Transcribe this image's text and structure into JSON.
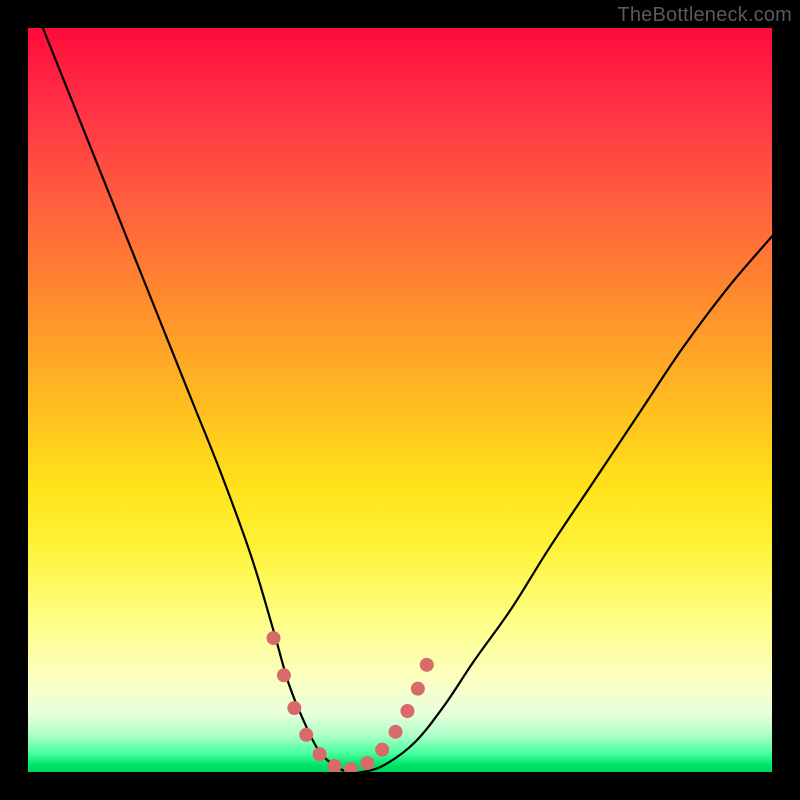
{
  "watermark": {
    "text": "TheBottleneck.com"
  },
  "colors": {
    "background": "#000000",
    "curve_stroke": "#000000",
    "marker_fill": "#d86a6a",
    "gradient_top": "#ff0a3a",
    "gradient_bottom": "#00d35f"
  },
  "chart_data": {
    "type": "line",
    "title": "",
    "xlabel": "",
    "ylabel": "",
    "xlim": [
      0,
      100
    ],
    "ylim": [
      0,
      100
    ],
    "grid": false,
    "legend": false,
    "series": [
      {
        "name": "bottleneck-curve",
        "x": [
          2,
          6,
          10,
          14,
          18,
          22,
          26,
          30,
          33,
          35,
          37,
          39,
          41,
          43,
          45,
          48,
          52,
          56,
          60,
          65,
          70,
          76,
          82,
          88,
          94,
          100
        ],
        "y": [
          100,
          90,
          80,
          70,
          60,
          50,
          40,
          29,
          19,
          12,
          7,
          3,
          1,
          0,
          0,
          1,
          4,
          9,
          15,
          22,
          30,
          39,
          48,
          57,
          65,
          72
        ]
      }
    ],
    "markers": {
      "name": "highlight-points",
      "x": [
        33.0,
        34.4,
        35.8,
        37.4,
        39.2,
        41.2,
        43.4,
        45.6,
        47.6,
        49.4,
        51.0,
        52.4,
        53.6
      ],
      "y": [
        18.0,
        13.0,
        8.6,
        5.0,
        2.4,
        0.8,
        0.4,
        1.2,
        3.0,
        5.4,
        8.2,
        11.2,
        14.4
      ]
    },
    "annotations": []
  }
}
